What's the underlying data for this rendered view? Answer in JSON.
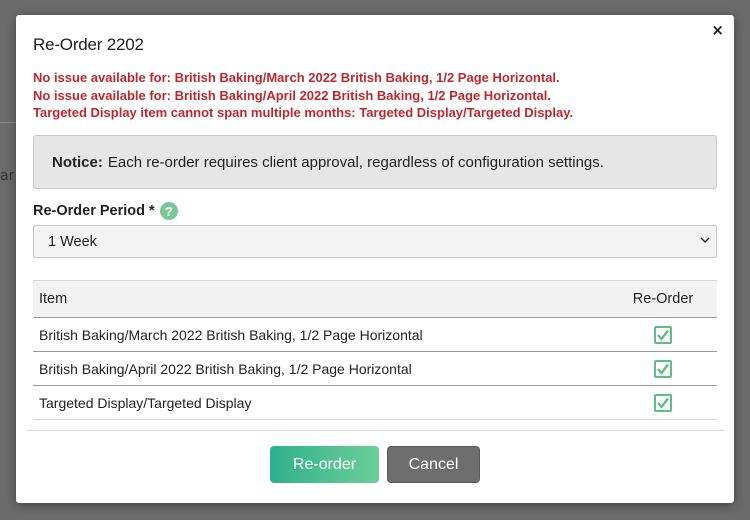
{
  "background": {
    "fragment_text": "ar"
  },
  "modal": {
    "title": "Re-Order 2202",
    "close_label": "×",
    "errors": [
      "No issue available for: British Baking/March 2022 British Baking, 1/2 Page Horizontal.",
      "No issue available for: British Baking/April 2022 British Baking, 1/2 Page Horizontal.",
      "Targeted Display item cannot span multiple months: Targeted Display/Targeted Display."
    ],
    "notice": {
      "label": "Notice:",
      "text": "Each re-order requires client approval, regardless of configuration settings."
    },
    "period": {
      "label": "Re-Order Period *",
      "help": "?",
      "selected": "1 Week"
    },
    "table": {
      "headers": {
        "item": "Item",
        "reorder": "Re-Order"
      },
      "rows": [
        {
          "item": "British Baking/March 2022 British Baking, 1/2 Page Horizontal",
          "checked": true
        },
        {
          "item": "British Baking/April 2022 British Baking, 1/2 Page Horizontal",
          "checked": true
        },
        {
          "item": "Targeted Display/Targeted Display",
          "checked": true
        }
      ]
    },
    "buttons": {
      "reorder": "Re-order",
      "cancel": "Cancel"
    }
  },
  "colors": {
    "error": "#c0272d",
    "accent": "#5cbf85",
    "cancel": "#6e6e6e"
  }
}
